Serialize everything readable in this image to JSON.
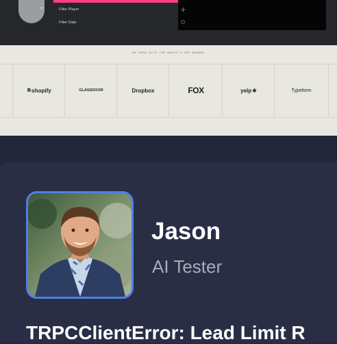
{
  "website": {
    "menu_items": [
      "Filter Player",
      "Filter Data"
    ],
    "tagline": "WE WORK WITH THE WORLD'S TOP BRANDS",
    "logos": [
      "shopify",
      "GLASSDOOR",
      "Dropbox",
      "FOX",
      "yelp",
      "Typeform"
    ]
  },
  "profile": {
    "name": "Jason",
    "role": "AI Tester"
  },
  "error_message": "TRPCClientError: Lead Limit R",
  "colors": {
    "background": "#212639",
    "card": "#2a2e45",
    "photo_border": "#4f7fea",
    "pink_accent": "#ff3e8a",
    "site_bg": "#e9e8e0"
  }
}
